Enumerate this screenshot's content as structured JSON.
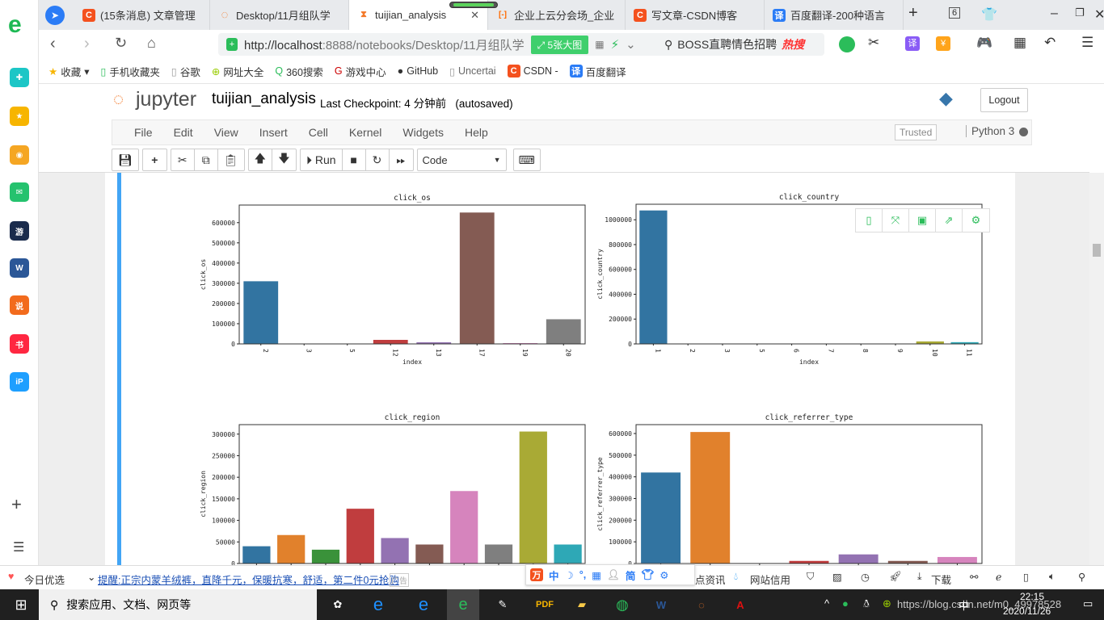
{
  "browser": {
    "tabs": [
      {
        "label": "(15条消息) 文章管理",
        "icon": "csdn-icon",
        "color": "#f4511e",
        "glyph": "C"
      },
      {
        "label": "Desktop/11月组队学",
        "icon": "jupyter-icon",
        "color": "#f37726",
        "glyph": "◌"
      },
      {
        "label": "tuijian_analysis",
        "icon": "hourglass-icon",
        "color": "#f37726",
        "glyph": "⧗",
        "active": true
      },
      {
        "label": "企业上云分会场_企业",
        "icon": "aliyun-icon",
        "color": "#ff6a00",
        "glyph": "[-]"
      },
      {
        "label": "写文章-CSDN博客",
        "icon": "csdn-icon",
        "color": "#f4511e",
        "glyph": "C"
      },
      {
        "label": "百度翻译-200种语言",
        "icon": "translate-icon",
        "color": "#2b7cf6",
        "glyph": "译"
      }
    ],
    "tab_count": "6",
    "url_host": "http://localhost",
    "url_rest": ":8888/notebooks/Desktop/11月组队学",
    "big_image_label": "5张大图",
    "search_text": "BOSS直聘情色招聘",
    "hot_label": "热搜",
    "bookmarks": [
      "收藏",
      "手机收藏夹",
      "谷歌",
      "网址大全",
      "360搜索",
      "游戏中心",
      "GitHub",
      "Uncertai",
      "CSDN -",
      "百度翻译"
    ]
  },
  "jupyter": {
    "logo_text": "jupyter",
    "notebook_name": "tuijian_analysis",
    "checkpoint": "Last Checkpoint: 4 分钟前",
    "autosaved": "(autosaved)",
    "logout": "Logout",
    "menus": [
      "File",
      "Edit",
      "View",
      "Insert",
      "Cell",
      "Kernel",
      "Widgets",
      "Help"
    ],
    "trusted": "Trusted",
    "kernel": "Python 3",
    "run_label": "Run",
    "cell_type": "Code"
  },
  "chart_data": [
    {
      "type": "bar",
      "title": "click_os",
      "xlabel": "index",
      "ylabel": "click_os",
      "categories": [
        "2",
        "3",
        "5",
        "12",
        "13",
        "17",
        "19",
        "20"
      ],
      "values": [
        310000,
        0,
        0,
        20000,
        8000,
        650000,
        4000,
        122000
      ],
      "yticks": [
        0,
        100000,
        200000,
        300000,
        400000,
        500000,
        600000
      ],
      "ylim": [
        0,
        687000
      ]
    },
    {
      "type": "bar",
      "title": "click_country",
      "xlabel": "index",
      "ylabel": "click_country",
      "categories": [
        "1",
        "2",
        "3",
        "5",
        "6",
        "7",
        "8",
        "9",
        "10",
        "11"
      ],
      "values": [
        1075000,
        0,
        0,
        0,
        0,
        0,
        0,
        0,
        20000,
        14000
      ],
      "yticks": [
        0,
        200000,
        400000,
        600000,
        800000,
        1000000
      ],
      "ylim": [
        0,
        1125000
      ]
    },
    {
      "type": "bar",
      "title": "click_region",
      "xlabel": "",
      "ylabel": "click_region",
      "categories": [
        "",
        "",
        "",
        "",
        "",
        "",
        "",
        "",
        "",
        ""
      ],
      "values": [
        40000,
        66000,
        32000,
        127000,
        59000,
        44000,
        168000,
        44000,
        306000,
        44000
      ],
      "yticks": [
        0,
        50000,
        100000,
        150000,
        200000,
        250000,
        300000
      ],
      "ylim": [
        0,
        322000
      ]
    },
    {
      "type": "bar",
      "title": "click_referrer_type",
      "xlabel": "",
      "ylabel": "click_referrer_type",
      "categories": [
        "",
        "",
        "",
        "",
        "",
        "",
        ""
      ],
      "values": [
        420000,
        607000,
        0,
        12000,
        42000,
        12000,
        30000
      ],
      "yticks": [
        0,
        100000,
        200000,
        300000,
        400000,
        500000,
        600000
      ],
      "ylim": [
        0,
        641000
      ]
    }
  ],
  "palette": [
    "#3274a1",
    "#e1812c",
    "#3a923a",
    "#c03d3e",
    "#9372b2",
    "#845b53",
    "#d684bd",
    "#7f7f7f",
    "#a9aa35",
    "#2ea8b6"
  ],
  "status": {
    "today": "今日优选",
    "promo": "提醒:正宗内蒙羊绒裤，直降千元，保暖抗寒，舒适，第二件0元抢购",
    "ad": "广告",
    "news": "点资讯",
    "site_credit": "网站信用",
    "download": "下载",
    "ime": [
      "中",
      "简"
    ]
  },
  "taskbar": {
    "search": "搜索应用、文档、网页等",
    "time": "22:15",
    "date": "2020/11/26",
    "lang": "中",
    "watermark": "https://blog.csdn.net/m0_49978528"
  }
}
